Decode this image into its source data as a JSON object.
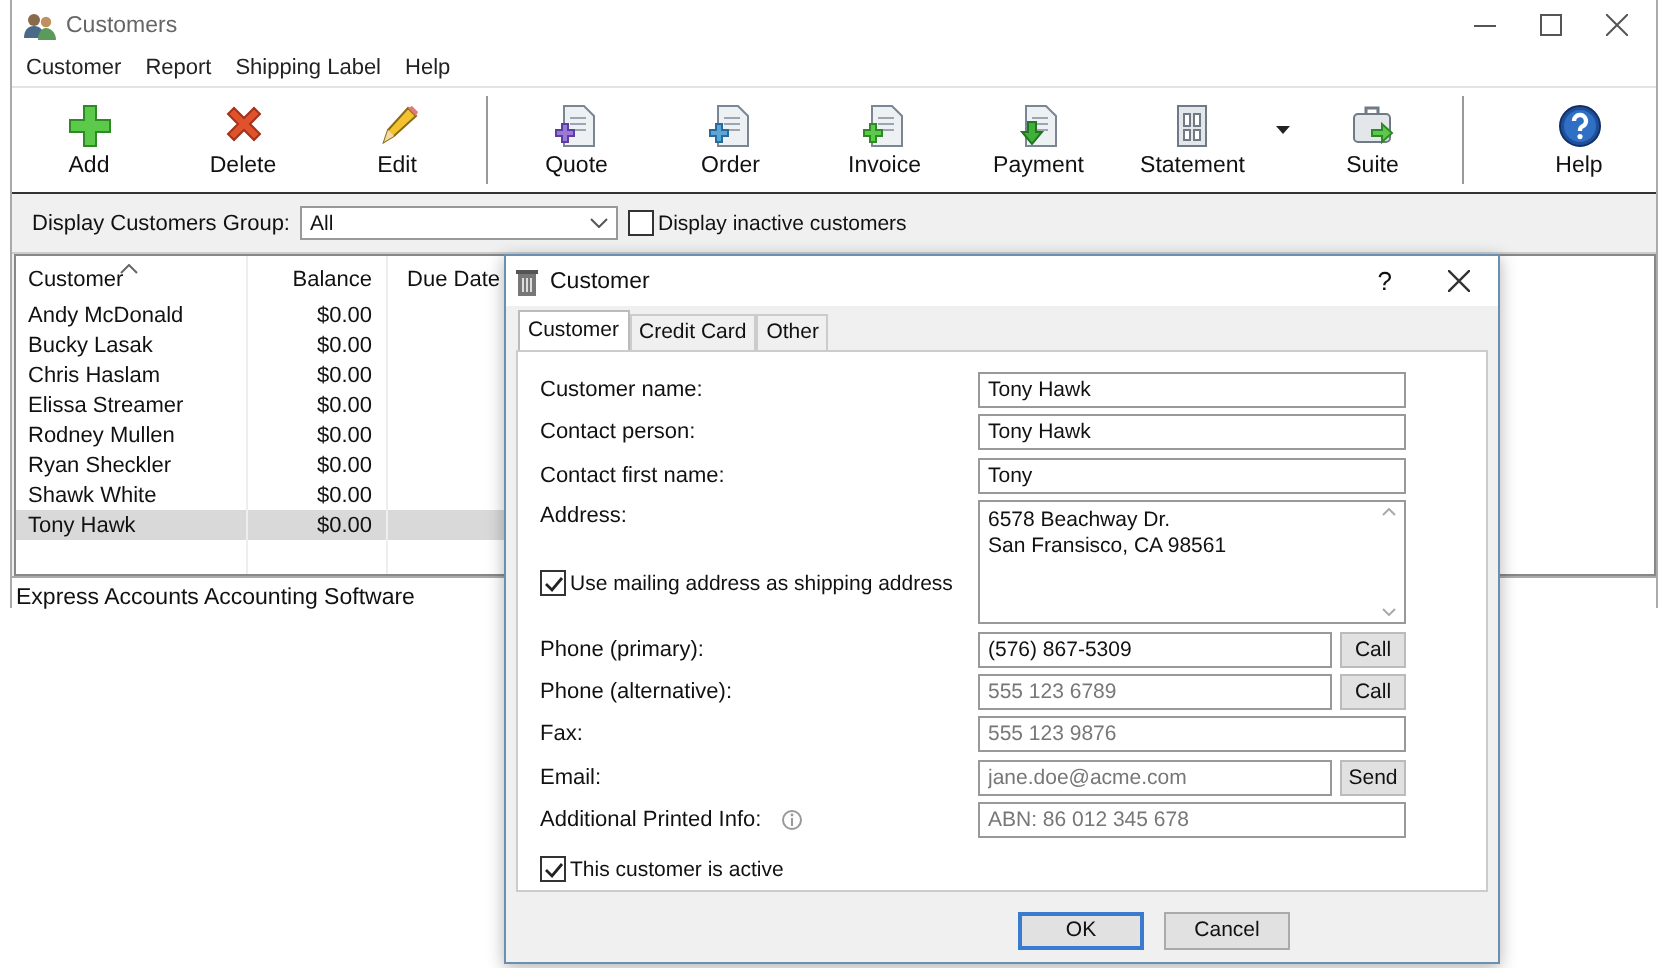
{
  "window": {
    "title": "Customers"
  },
  "menu": [
    "Customer",
    "Report",
    "Shipping Label",
    "Help"
  ],
  "toolbar": [
    [
      {
        "label": "Add",
        "dropdown": false
      },
      {
        "label": "Delete",
        "dropdown": false
      },
      {
        "label": "Edit",
        "dropdown": false
      }
    ],
    [
      {
        "label": "Quote",
        "dropdown": false
      },
      {
        "label": "Order",
        "dropdown": false
      },
      {
        "label": "Invoice",
        "dropdown": false
      },
      {
        "label": "Payment",
        "dropdown": false
      },
      {
        "label": "Statement",
        "dropdown": true
      },
      {
        "label": "Suite",
        "dropdown": false
      }
    ],
    [
      {
        "label": "Help",
        "dropdown": false
      }
    ]
  ],
  "filter": {
    "label": "Display Customers Group:",
    "value": "All",
    "inactive": {
      "label": "Display inactive customers",
      "checked": false
    }
  },
  "table": {
    "columns": [
      {
        "label": "Customer",
        "sorted": true
      },
      {
        "label": "Balance",
        "sorted": false
      },
      {
        "label": "Due Date",
        "sorted": false
      }
    ],
    "rows": [
      {
        "customer": "Andy McDonald",
        "balance": "$0.00",
        "selected": false
      },
      {
        "customer": "Bucky Lasak",
        "balance": "$0.00",
        "selected": false
      },
      {
        "customer": "Chris Haslam",
        "balance": "$0.00",
        "selected": false
      },
      {
        "customer": "Elissa Streamer",
        "balance": "$0.00",
        "selected": false
      },
      {
        "customer": "Rodney Mullen",
        "balance": "$0.00",
        "selected": false
      },
      {
        "customer": "Ryan Sheckler",
        "balance": "$0.00",
        "selected": false
      },
      {
        "customer": "Shawk White",
        "balance": "$0.00",
        "selected": false
      },
      {
        "customer": "Tony Hawk",
        "balance": "$0.00",
        "selected": true
      }
    ]
  },
  "status_bar": "Express Accounts Accounting Software",
  "dialog": {
    "title": "Customer",
    "help": "?",
    "tabs": [
      {
        "label": "Customer",
        "selected": true
      },
      {
        "label": "Credit Card",
        "selected": false
      },
      {
        "label": "Other",
        "selected": false
      }
    ],
    "fields": [
      {
        "kind": "text",
        "label": "Customer name:",
        "value": "Tony Hawk"
      },
      {
        "kind": "text",
        "label": "Contact person:",
        "value": "Tony Hawk"
      },
      {
        "kind": "text",
        "label": "Contact first name:",
        "value": "Tony"
      },
      {
        "kind": "address",
        "label": "Address:",
        "lines": [
          "6578 Beachway Dr.",
          "San Fransisco, CA 98561"
        ],
        "option": {
          "label": "Use mailing address as shipping address",
          "checked": true
        }
      },
      {
        "kind": "text",
        "label": "Phone (primary):",
        "value": "(576) 867-5309",
        "action": "Call"
      },
      {
        "kind": "text",
        "label": "Phone (alternative):",
        "placeholder": "555 123 6789",
        "action": "Call"
      },
      {
        "kind": "text",
        "label": "Fax:",
        "placeholder": "555 123 9876"
      },
      {
        "kind": "text",
        "label": "Email:",
        "placeholder": "jane.doe@acme.com",
        "action": "Send"
      },
      {
        "kind": "text",
        "label": "Additional Printed Info:",
        "placeholder": "ABN: 86 012 345 678",
        "info": true
      }
    ],
    "active": {
      "label": "This customer is active",
      "checked": true
    },
    "buttons": [
      {
        "label": "OK",
        "default": true
      },
      {
        "label": "Cancel",
        "default": false
      }
    ]
  }
}
